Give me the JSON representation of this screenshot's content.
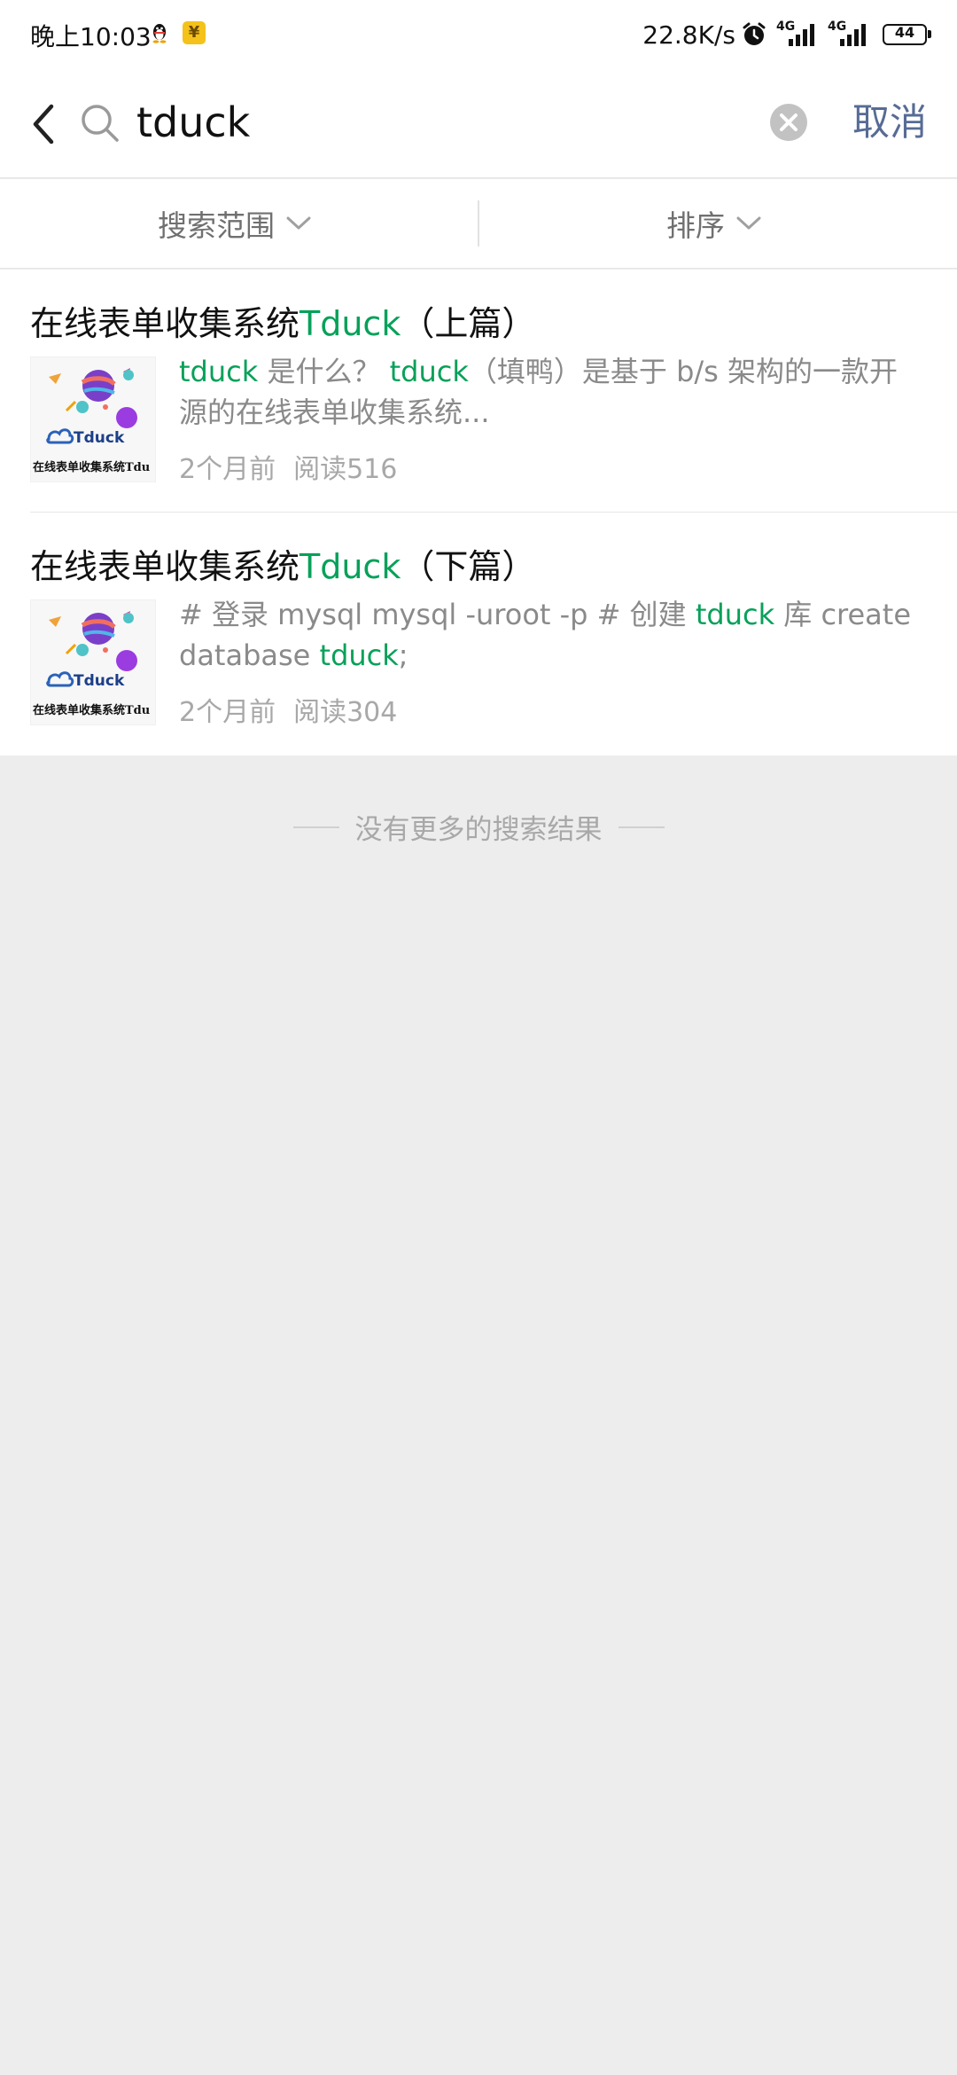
{
  "status_bar": {
    "time": "晚上10:03",
    "pay_glyph": "¥",
    "network_speed": "22.8K/s",
    "signal_label_1": "4G",
    "signal_label_2": "4G",
    "battery": "44"
  },
  "search": {
    "query": "tduck",
    "cancel_label": "取消"
  },
  "filters": {
    "scope_label": "搜索范围",
    "sort_label": "排序"
  },
  "results": [
    {
      "title_prefix": "在线表单收集系统",
      "title_highlight": "Tduck",
      "title_suffix": "（上篇）",
      "thumb_brand": "Tduck",
      "thumb_caption": "在线表单收集系统Tdu",
      "snippet_hl1": "tduck",
      "snippet_t1": " 是什么？ ",
      "snippet_hl2": "tduck",
      "snippet_t2": "（填鸭）是基于 b/s 架构的一款开源的在线表单收集系统...",
      "time": "2个月前",
      "reads": "阅读516"
    },
    {
      "title_prefix": "在线表单收集系统",
      "title_highlight": "Tduck",
      "title_suffix": "（下篇）",
      "thumb_brand": "Tduck",
      "thumb_caption": "在线表单收集系统Tdu",
      "snippet_t1": "# 登录 mysql mysql -uroot -p # 创建 ",
      "snippet_hl1": "tduck",
      "snippet_t2": " 库 create database ",
      "snippet_hl2": "tduck",
      "snippet_t3": ";",
      "time": "2个月前",
      "reads": "阅读304"
    }
  ],
  "footer": {
    "no_more_text": "没有更多的搜索结果"
  },
  "colors": {
    "highlight": "#07a15a",
    "cancel": "#576b95",
    "page_bg": "#ededed"
  }
}
